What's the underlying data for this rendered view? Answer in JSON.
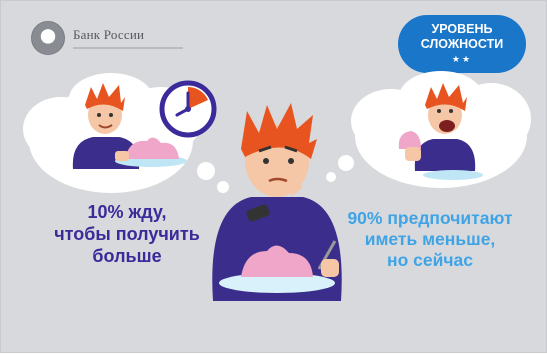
{
  "logo": {
    "title": "Банк России",
    "icon": "bank-emblem-icon"
  },
  "badge": {
    "line1": "УРОВЕНЬ",
    "line2": "СЛОЖНОСТИ",
    "stars": "★★"
  },
  "captions": {
    "left": [
      "10% жду,",
      "чтобы получить",
      "больше"
    ],
    "right": [
      "90% предпочитают",
      "иметь меньше,",
      "но сейчас"
    ]
  },
  "colors": {
    "background": "#d8d9dd",
    "badge": "#1976c9",
    "left_caption": "#3b2a9a",
    "right_caption": "#3fa4e6",
    "hair": "#e8541f",
    "shirt": "#3a2d8c",
    "dessert": "#f0a6c8",
    "clock": "#3b2a9a"
  }
}
